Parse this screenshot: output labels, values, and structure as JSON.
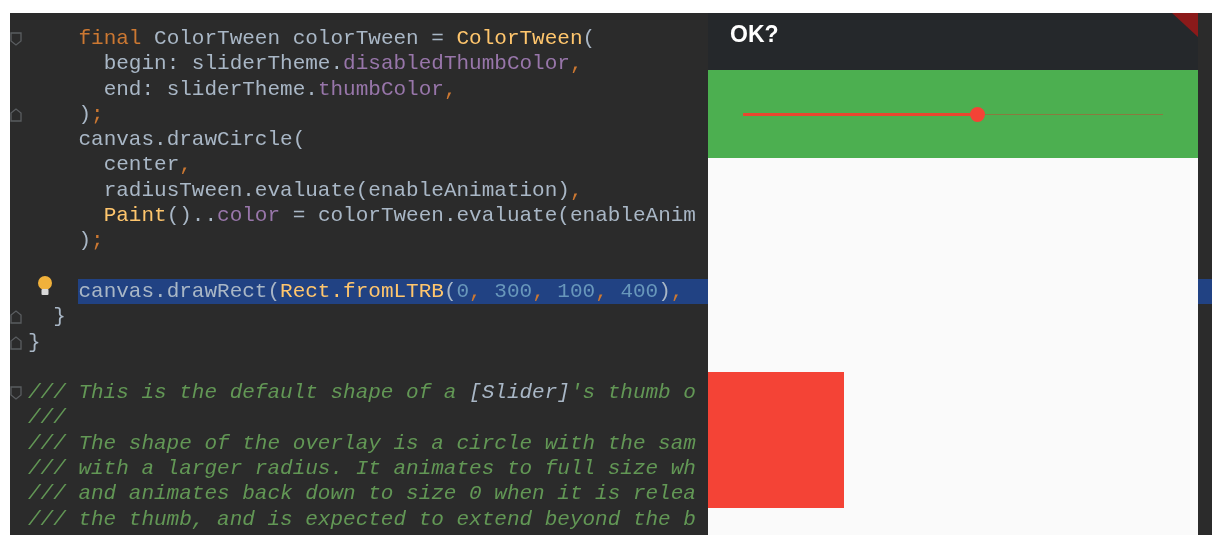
{
  "editor": {
    "blocks": [
      {
        "lines": [
          {
            "kind": "foldstart",
            "selected": false,
            "tokens": [
              {
                "kind": "keyword",
                "text": "    final "
              },
              {
                "kind": "plain",
                "text": "ColorTween colorTween = "
              },
              {
                "kind": "call",
                "text": "ColorTween"
              },
              {
                "kind": "plain",
                "text": "("
              }
            ]
          },
          {
            "kind": "plain",
            "selected": false,
            "tokens": [
              {
                "kind": "plain",
                "text": "      begin: sliderTheme."
              },
              {
                "kind": "field",
                "text": "disabledThumbColor"
              },
              {
                "kind": "keyword",
                "text": ","
              }
            ]
          },
          {
            "kind": "plain",
            "selected": false,
            "tokens": [
              {
                "kind": "plain",
                "text": "      end: sliderTheme."
              },
              {
                "kind": "field",
                "text": "thumbColor"
              },
              {
                "kind": "keyword",
                "text": ","
              }
            ]
          },
          {
            "kind": "foldend",
            "selected": false,
            "tokens": [
              {
                "kind": "plain",
                "text": "    )"
              },
              {
                "kind": "keyword",
                "text": ";"
              }
            ]
          },
          {
            "kind": "plain",
            "selected": false,
            "tokens": [
              {
                "kind": "plain",
                "text": "    canvas.drawCircle("
              }
            ]
          },
          {
            "kind": "plain",
            "selected": false,
            "tokens": [
              {
                "kind": "plain",
                "text": "      center"
              },
              {
                "kind": "keyword",
                "text": ","
              }
            ]
          },
          {
            "kind": "plain",
            "selected": false,
            "tokens": [
              {
                "kind": "plain",
                "text": "      radiusTween.evaluate(enableAnimation)"
              },
              {
                "kind": "keyword",
                "text": ","
              }
            ]
          },
          {
            "kind": "plain",
            "selected": false,
            "tokens": [
              {
                "kind": "call",
                "text": "      Paint"
              },
              {
                "kind": "plain",
                "text": "().."
              },
              {
                "kind": "field",
                "text": "color"
              },
              {
                "kind": "plain",
                "text": " = colorTween.evaluate(enableAnim"
              }
            ]
          },
          {
            "kind": "plain",
            "selected": false,
            "tokens": [
              {
                "kind": "plain",
                "text": "    )"
              },
              {
                "kind": "keyword",
                "text": ";"
              }
            ]
          }
        ]
      },
      {
        "lines": [
          {
            "kind": "intention",
            "selected": true,
            "tokens": [
              {
                "kind": "plain",
                "text": "    canvas.drawRect("
              },
              {
                "kind": "call",
                "text": "Rect.fromLTRB"
              },
              {
                "kind": "plain",
                "text": "("
              },
              {
                "kind": "number",
                "text": "0"
              },
              {
                "kind": "keyword",
                "text": ", "
              },
              {
                "kind": "number",
                "text": "300"
              },
              {
                "kind": "keyword",
                "text": ", "
              },
              {
                "kind": "number",
                "text": "100"
              },
              {
                "kind": "keyword",
                "text": ", "
              },
              {
                "kind": "number",
                "text": "400"
              },
              {
                "kind": "plain",
                "text": ")"
              },
              {
                "kind": "keyword",
                "text": ", "
              }
            ]
          },
          {
            "kind": "foldend",
            "selected": false,
            "tokens": [
              {
                "kind": "plain",
                "text": "  }"
              }
            ]
          },
          {
            "kind": "foldend",
            "selected": false,
            "tokens": [
              {
                "kind": "plain",
                "text": "}"
              }
            ]
          }
        ]
      },
      {
        "lines": [
          {
            "kind": "foldstart",
            "selected": false,
            "tokens": [
              {
                "kind": "comment",
                "text": "/// This is the default shape of a "
              },
              {
                "kind": "comment_ref",
                "text": "[Slider]"
              },
              {
                "kind": "comment",
                "text": "'s thumb o"
              }
            ]
          },
          {
            "kind": "plain",
            "selected": false,
            "tokens": [
              {
                "kind": "comment",
                "text": "///"
              }
            ]
          },
          {
            "kind": "plain",
            "selected": false,
            "tokens": [
              {
                "kind": "comment",
                "text": "/// The shape of the overlay is a circle with the sam"
              }
            ]
          },
          {
            "kind": "plain",
            "selected": false,
            "tokens": [
              {
                "kind": "comment",
                "text": "/// with a larger radius. It animates to full size wh"
              }
            ]
          },
          {
            "kind": "plain",
            "selected": false,
            "tokens": [
              {
                "kind": "comment",
                "text": "/// and animates back down to size 0 when it is relea"
              }
            ]
          },
          {
            "kind": "plain",
            "selected": false,
            "tokens": [
              {
                "kind": "comment",
                "text": "/// the thumb, and is expected to extend beyond the b"
              }
            ]
          }
        ]
      }
    ]
  },
  "app": {
    "title": "OK?",
    "debug_banner": true,
    "slider": {
      "level": 0.556
    }
  }
}
